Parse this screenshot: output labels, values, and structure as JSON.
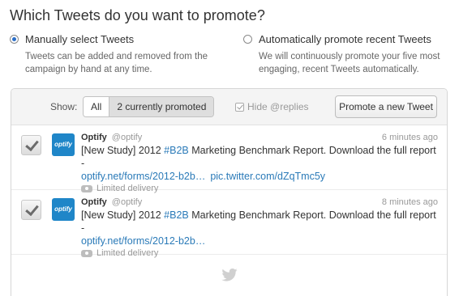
{
  "page": {
    "title": "Which Tweets do you want to promote?"
  },
  "options": {
    "manual": {
      "label": "Manually select Tweets",
      "description": "Tweets can be added and removed from the campaign by hand at any time.",
      "selected": true
    },
    "automatic": {
      "label": "Automatically promote recent Tweets",
      "description": "We will continuously promote your five most engaging, recent Tweets automatically.",
      "selected": false
    }
  },
  "toolbar": {
    "show_label": "Show:",
    "filter_all": "All",
    "filter_promoted": "2 currently promoted",
    "active_filter": "2 currently promoted",
    "hide_replies_label": "Hide @replies",
    "hide_replies_checked": true,
    "promote_button": "Promote a new Tweet"
  },
  "tweets": [
    {
      "checked": true,
      "avatar_text": "optify",
      "name": "Optify",
      "handle": "@optify",
      "time": "6 minutes ago",
      "text_before": "[New Study] 2012 ",
      "hashtag": "#B2B",
      "text_after": " Marketing Benchmark Report. Download the full report -",
      "link1": "optify.net/forms/2012-b2b…",
      "link2": "pic.twitter.com/dZqTmc5y",
      "delivery": "Limited delivery"
    },
    {
      "checked": true,
      "avatar_text": "optify",
      "name": "Optify",
      "handle": "@optify",
      "time": "8 minutes ago",
      "text_before": "[New Study] 2012 ",
      "hashtag": "#B2B",
      "text_after": " Marketing Benchmark Report. Download the full report -",
      "link1": "optify.net/forms/2012-b2b…",
      "link2": "",
      "delivery": "Limited delivery"
    }
  ],
  "colors": {
    "link": "#2a7ab8",
    "avatar_bg": "#1f86c8",
    "radio_selected": "#2a6ec8"
  },
  "icons": {
    "footer": "twitter-bird-icon",
    "delivery": "eye-icon"
  }
}
